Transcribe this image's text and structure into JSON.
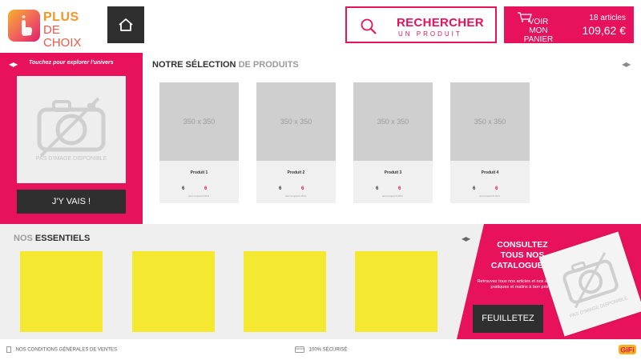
{
  "header": {
    "logo": {
      "line1": "PLUS",
      "line2": "DE CHOIX"
    },
    "home_icon": "home-icon",
    "search": {
      "title": "RECHERCHER",
      "subtitle": "UN PRODUIT",
      "icon": "search-icon"
    },
    "cart": {
      "label_line1": "VOIR",
      "label_line2": "MON PANIER",
      "count": "18 articles",
      "total": "109,62 €",
      "icon": "cart-icon"
    }
  },
  "univers": {
    "hint": "Touchez pour explorer l'univers",
    "image_placeholder": "PAS D'IMAGE DISPONIBLE",
    "button": "J'Y VAIS !"
  },
  "selection": {
    "title_bold": "NOTRE SÉLECTION",
    "title_light": "DE PRODUITS",
    "products": [
      {
        "name": "Produit 1",
        "thumb": "350 x 350",
        "old_price": "6",
        "new_price": "6",
        "note": "dont écopart 0,05 €"
      },
      {
        "name": "Produit 2",
        "thumb": "350 x 350",
        "old_price": "6",
        "new_price": "6",
        "note": "dont écopart 0,05 €"
      },
      {
        "name": "Produit 3",
        "thumb": "350 x 350",
        "old_price": "6",
        "new_price": "6",
        "note": "dont écopart 0,05 €"
      },
      {
        "name": "Produit 4",
        "thumb": "350 x 350",
        "old_price": "6",
        "new_price": "6",
        "note": "dont écopart 0,05 €"
      }
    ]
  },
  "essentials": {
    "title_light": "NOS",
    "title_bold": "ESSENTIELS",
    "tiles": 4
  },
  "catalog": {
    "title": "CONSULTEZ TOUS NOS CATALOGUES !",
    "description": "Retrouvez tous nos articles et nos essentiels pratiques et malins à bon prix !",
    "button": "FEUILLETEZ",
    "image_placeholder": "PAS D'IMAGE DISPONIBLE"
  },
  "footer": {
    "conditions": "NOS CONDITIONS GÉNÉRALES DE VENTES",
    "secure": "100% SÉCURISÉ",
    "brand": "GiFi"
  },
  "colors": {
    "accent": "#e8115b",
    "dark": "#2f2f2f",
    "tile": "#f4e830",
    "panel": "#efefef"
  }
}
